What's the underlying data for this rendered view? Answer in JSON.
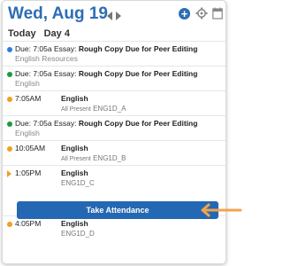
{
  "header": {
    "date": "Wed, Aug 19",
    "today_label": "Today",
    "day_label": "Day 4"
  },
  "icons": {
    "prev": "chevron-left-icon",
    "next": "chevron-right-icon",
    "add": "plus-circle-icon",
    "settings": "gear-icon",
    "calendar": "calendar-icon"
  },
  "colors": {
    "accent": "#2d6db5",
    "button": "#2468b3",
    "dot_blue": "#2d7de0",
    "dot_green": "#1e9a3c",
    "dot_orange": "#f0a020",
    "arrow": "#f0a450"
  },
  "items": [
    {
      "kind": "due",
      "dot": "blue",
      "prefix": "Due: 7:05a Essay:",
      "title": "Rough Copy Due for Peer Editing",
      "sub": "English Resources"
    },
    {
      "kind": "due",
      "dot": "green",
      "prefix": "Due: 7:05a Essay:",
      "title": "Rough Copy Due for Peer Editing",
      "sub": "English"
    },
    {
      "kind": "class",
      "dot": "orange",
      "time": "7:05AM",
      "course": "English",
      "status": "All Present",
      "section": "ENG1D_A"
    },
    {
      "kind": "due",
      "dot": "green",
      "prefix": "Due: 7:05a Essay:",
      "title": "Rough Copy Due for Peer Editing",
      "sub": "English"
    },
    {
      "kind": "class",
      "dot": "orange",
      "time": "10:05AM",
      "course": "English",
      "status": "All Present",
      "section": "ENG1D_B"
    },
    {
      "kind": "class",
      "dot": "orange-triangle",
      "time": "1:05PM",
      "course": "English",
      "section": "ENG1D_C",
      "button": "Take Attendance"
    },
    {
      "kind": "class",
      "dot": "orange",
      "time": "4:05PM",
      "course": "English",
      "section": "ENG1D_D"
    }
  ]
}
